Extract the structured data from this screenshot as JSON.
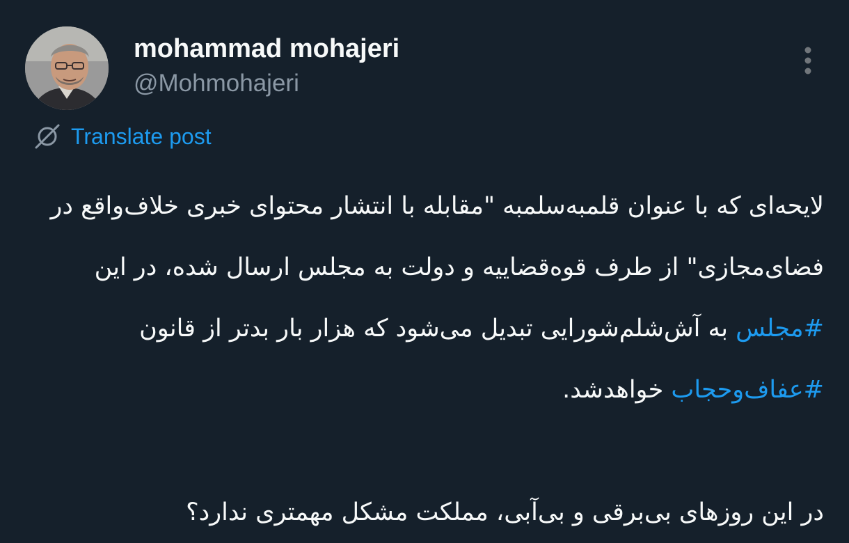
{
  "author": {
    "display_name": "mohammad mohajeri",
    "handle": "@Mohmohajeri"
  },
  "icons": {
    "more": "more-vertical-icon",
    "translate": "translate-globe-icon"
  },
  "translate_label": "Translate post",
  "body": {
    "paragraph1": {
      "part1": "لایحه‌ای که با عنوان قلمبه‌سلمبه \"مقابله با انتشار محتوای خبری خلاف‌واقع در فضای‌مجازی\" از طرف قوه‌قضاییه و دولت به مجلس ارسال شده، در این ",
      "hashtag1": "#مجلس",
      "part2": " به آش‌شلم‌شورایی تبدیل می‌شود که هزار بار بدتر از قانون ",
      "hashtag2": "#عفاف‌وحجاب",
      "part3": " خواهدشد."
    },
    "paragraph2": "در این روزهای بی‌برقی و بی‌آبی، مملکت مشکل مهمتری ندارد؟"
  },
  "colors": {
    "background": "#15202b",
    "text": "#f7f9f9",
    "secondary": "#8b98a5",
    "accent": "#1d9bf0"
  }
}
